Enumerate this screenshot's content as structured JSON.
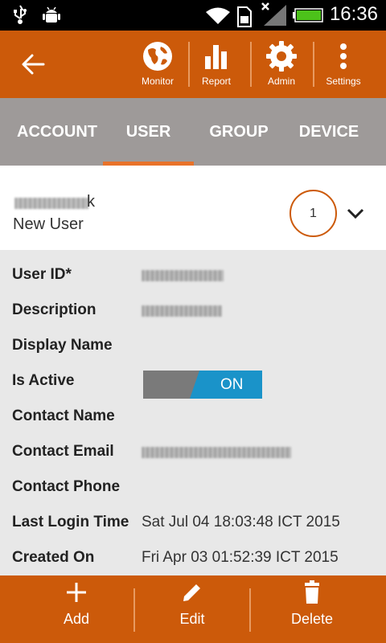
{
  "status_bar": {
    "time": "16:36",
    "icons": [
      "usb-icon",
      "android-debug-icon",
      "wifi-icon",
      "sim-icon",
      "signal-icon",
      "battery-icon"
    ]
  },
  "toolbar": {
    "accent": "#cc5a0a",
    "actions": [
      {
        "label": "Monitor",
        "icon": "globe-icon"
      },
      {
        "label": "Report",
        "icon": "bar-chart-icon"
      },
      {
        "label": "Admin",
        "icon": "gear-icon"
      },
      {
        "label": "Settings",
        "icon": "overflow-menu-icon"
      }
    ]
  },
  "tabs": [
    {
      "label": "ACCOUNT",
      "selected": false
    },
    {
      "label": "USER",
      "selected": true
    },
    {
      "label": "GROUP",
      "selected": false
    },
    {
      "label": "DEVICE",
      "selected": false
    }
  ],
  "record_header": {
    "name_visible": "k",
    "subtitle": "New User",
    "count": "1"
  },
  "details": {
    "rows": [
      {
        "label": "User ID*",
        "value": ""
      },
      {
        "label": "Description",
        "value": ""
      },
      {
        "label": "Display Name",
        "value": ""
      },
      {
        "label": "Is Active",
        "toggle_text": "ON",
        "toggle_on": true
      },
      {
        "label": "Contact Name",
        "value": ""
      },
      {
        "label": "Contact Email",
        "value": ""
      },
      {
        "label": "Contact Phone",
        "value": ""
      },
      {
        "label": "Last Login Time",
        "value": "Sat Jul 04 18:03:48 ICT 2015"
      },
      {
        "label": "Created On",
        "value": "Fri Apr 03 01:52:39 ICT 2015"
      }
    ]
  },
  "bottom_bar": {
    "actions": [
      {
        "label": "Add",
        "icon": "plus-icon"
      },
      {
        "label": "Edit",
        "icon": "pencil-icon"
      },
      {
        "label": "Delete",
        "icon": "trash-icon"
      }
    ]
  }
}
